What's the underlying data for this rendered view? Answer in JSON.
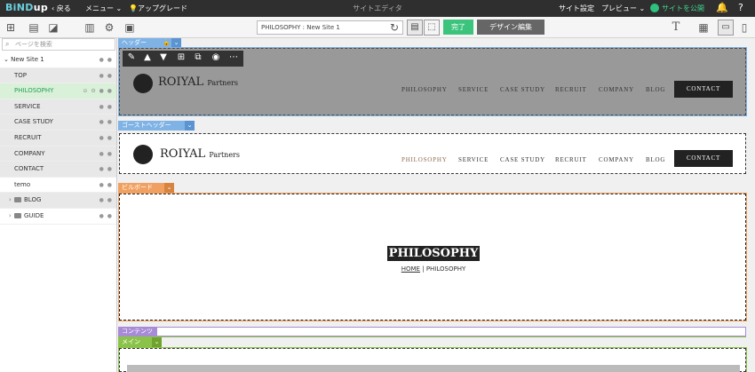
{
  "topbar": {
    "logo_b": "BiND",
    "logo_rest": "up",
    "back": "戻る",
    "menu": "メニュー",
    "upgrade": "アップグレード",
    "title": "サイトエディタ",
    "site_settings": "サイト設定",
    "preview": "プレビュー",
    "publish": "サイトを公開"
  },
  "toolbar": {
    "site_path": "PHILOSOPHY : New Site 1",
    "done": "完了",
    "design_edit": "デザイン編集",
    "font_icon": "T"
  },
  "sidebar": {
    "search_placeholder": "ページを検索",
    "root": "New Site 1",
    "items": [
      {
        "label": "TOP"
      },
      {
        "label": "PHILOSOPHY"
      },
      {
        "label": "SERVICE"
      },
      {
        "label": "CASE STUDY"
      },
      {
        "label": "RECRUIT"
      },
      {
        "label": "COMPANY"
      },
      {
        "label": "CONTACT"
      },
      {
        "label": "temo"
      },
      {
        "label": "BLOG"
      },
      {
        "label": "GUIDE"
      }
    ]
  },
  "canvas": {
    "header_tag": "ヘッダー",
    "ghost_header_tag": "ゴーストヘッダー",
    "billboard_tag": "ビルボード",
    "contents_tag": "コンテンツ",
    "main_tag": "メイン",
    "logo_name": "ROIYAL",
    "logo_sub": "Partners",
    "nav": [
      "PHILOSOPHY",
      "SERVICE",
      "CASE STUDY",
      "RECRUIT",
      "COMPANY",
      "BLOG"
    ],
    "contact": "CONTACT",
    "billboard_title": "PHILOSOPHY",
    "crumb_home": "HOME",
    "crumb_sep": "|",
    "crumb_current": "PHILOSOPHY"
  },
  "colors": {
    "accent_green": "#3cc47c",
    "header_tag": "#7fb2e5",
    "billboard_tag": "#f0a060",
    "contents_tag": "#a88bd6",
    "main_tag": "#8bc34a"
  }
}
